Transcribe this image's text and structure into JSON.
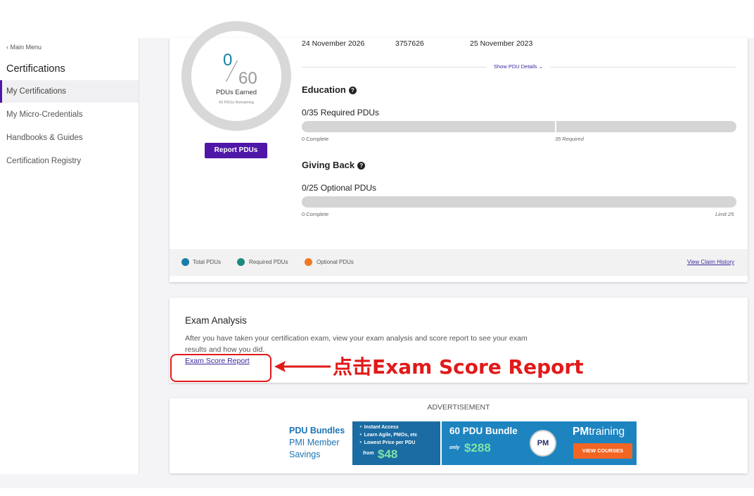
{
  "sidebar": {
    "back_label": "‹ Main Menu",
    "title": "Certifications",
    "items": [
      {
        "label": "My Certifications"
      },
      {
        "label": "My Micro-Credentials"
      },
      {
        "label": "Handbooks & Guides"
      },
      {
        "label": "Certification Registry"
      }
    ]
  },
  "certification": {
    "expiry_date": "24 November 2026",
    "cert_number": "3757626",
    "granted_date": "25 November 2023",
    "show_details_label": "Show PDU Details ⌄"
  },
  "pdu_ring": {
    "earned": "0",
    "total": "60",
    "label": "PDUs Earned",
    "remaining": "60 PDUs Remaining",
    "progress_fraction": 0
  },
  "report_button": "Report PDUs",
  "education": {
    "title": "Education",
    "required_label": "0/35 Required PDUs",
    "complete_label": "0 Complete",
    "required_marker": "35 Required",
    "progress_fraction": 0
  },
  "giving_back": {
    "title": "Giving Back",
    "optional_label": "0/25 Optional PDUs",
    "complete_label": "0 Complete",
    "limit_label": "Limit 25",
    "progress_fraction": 0
  },
  "legend": {
    "items": [
      {
        "label": "Total PDUs",
        "color": "#167da6"
      },
      {
        "label": "Required PDUs",
        "color": "#1b8a80"
      },
      {
        "label": "Optional PDUs",
        "color": "#f07823"
      }
    ],
    "claim_link": "View Claim History"
  },
  "exam_analysis": {
    "title": "Exam Analysis",
    "description": "After you have taken your certification exam, view your exam analysis and score report to see your exam results and how you did.",
    "link": "Exam Score Report"
  },
  "annotation": {
    "text": "点击Exam Score Report",
    "color": "#e11a1a"
  },
  "advertisement": {
    "label": "ADVERTISEMENT",
    "left_title": "PDU Bundles",
    "left_line2": "PMI Member",
    "left_line3": "Savings",
    "bullets": [
      "Instant Access",
      "Learn Agile, PMOs, etc",
      "Lowest Price per PDU"
    ],
    "from_label": "from",
    "from_price": "$48",
    "bundle_title": "60 PDU Bundle",
    "only_label": "only",
    "bundle_price": "$288",
    "logo_text": "PM",
    "brand_bold": "PM",
    "brand_rest": "training",
    "cta": "VIEW COURSES"
  },
  "colors": {
    "brand_purple": "#4f17a8",
    "link_purple": "#3a2b9e",
    "ring_earned": "#1784a6"
  }
}
